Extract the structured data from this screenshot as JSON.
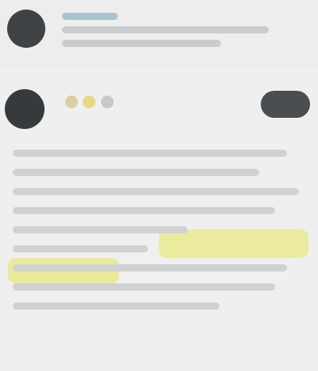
{
  "notification": {
    "avatar": "avatar-dark",
    "name": "",
    "line1": "",
    "line2": ""
  },
  "post": {
    "avatar": "avatar-dark",
    "badges": [
      "badge-tan",
      "badge-yellow",
      "badge-gray"
    ],
    "follow_label": "",
    "body_lines": [
      "",
      "",
      "",
      "",
      "",
      "",
      "",
      "",
      ""
    ]
  },
  "colors": {
    "background": "#efefef",
    "highlight": "#eaeb9d",
    "avatar": "#353a3c",
    "link": "#a9c2cf"
  }
}
